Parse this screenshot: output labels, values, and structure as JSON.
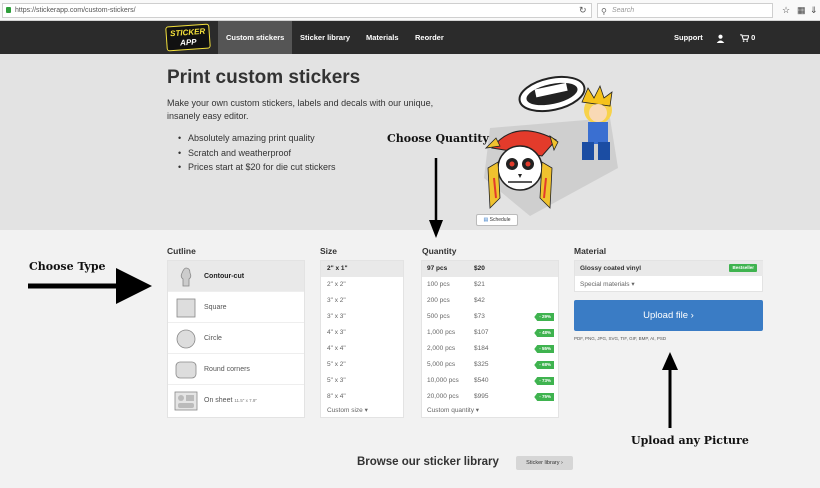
{
  "browser": {
    "url": "https://stickerapp.com/custom-stickers/",
    "search_placeholder": "Search",
    "reload_icon": "reload-icon"
  },
  "navbar": {
    "logo_line1": "STICKER",
    "logo_line2": "APP",
    "items": [
      {
        "label": "Custom stickers",
        "active": true
      },
      {
        "label": "Sticker library",
        "active": false
      },
      {
        "label": "Materials",
        "active": false
      },
      {
        "label": "Reorder",
        "active": false
      }
    ],
    "support": "Support",
    "cart_count": "0"
  },
  "hero": {
    "title": "Print custom stickers",
    "description": "Make your own custom stickers, labels and decals with our unique, insanely easy editor.",
    "bullets": [
      "Absolutely amazing print quality",
      "Scratch and weatherproof",
      "Prices start at $20 for die cut stickers"
    ],
    "schedule_label": "Schedule"
  },
  "annotations": {
    "choose_quantity": "Choose Quantity",
    "choose_type": "Choose Type",
    "upload_any_picture": "Upload any Picture"
  },
  "cutline": {
    "title": "Cutline",
    "options": [
      {
        "label": "Contour-cut",
        "active": true,
        "note": ""
      },
      {
        "label": "Square",
        "active": false,
        "note": ""
      },
      {
        "label": "Circle",
        "active": false,
        "note": ""
      },
      {
        "label": "Round corners",
        "active": false,
        "note": ""
      },
      {
        "label": "On sheet",
        "active": false,
        "note": "11.5\" x 7.9\""
      }
    ]
  },
  "size": {
    "title": "Size",
    "options": [
      "2\" x 1\"",
      "2\" x 2\"",
      "3\" x 2\"",
      "3\" x 3\"",
      "4\" x 3\"",
      "4\" x 4\"",
      "5\" x 2\"",
      "5\" x 3\"",
      "8\" x 4\""
    ],
    "custom": "Custom size"
  },
  "quantity": {
    "title": "Quantity",
    "options": [
      {
        "pcs": "97 pcs",
        "price": "$20",
        "discount": "",
        "active": true
      },
      {
        "pcs": "100 pcs",
        "price": "$21",
        "discount": ""
      },
      {
        "pcs": "200 pcs",
        "price": "$42",
        "discount": ""
      },
      {
        "pcs": "500 pcs",
        "price": "$73",
        "discount": "- 29%"
      },
      {
        "pcs": "1,000 pcs",
        "price": "$107",
        "discount": "- 48%"
      },
      {
        "pcs": "2,000 pcs",
        "price": "$184",
        "discount": "- 55%"
      },
      {
        "pcs": "5,000 pcs",
        "price": "$325",
        "discount": "- 68%"
      },
      {
        "pcs": "10,000 pcs",
        "price": "$540",
        "discount": "- 73%"
      },
      {
        "pcs": "20,000 pcs",
        "price": "$995",
        "discount": "- 75%"
      }
    ],
    "custom": "Custom quantity"
  },
  "material": {
    "title": "Material",
    "selected": "Glossy coated vinyl",
    "bestseller": "Bestseller",
    "special": "Special materials",
    "upload_label": "Upload file",
    "formats": "PDF, PNG, JPG, SVG, TIF, GIF, BMP, AI, PSD"
  },
  "browse": {
    "title": "Browse our sticker library",
    "button": "Sticker library"
  },
  "colors": {
    "navbar": "#2b2b2b",
    "upload_button": "#3a7cc5",
    "badge_green": "#3fb34f",
    "logo_yellow": "#f4e13c"
  }
}
